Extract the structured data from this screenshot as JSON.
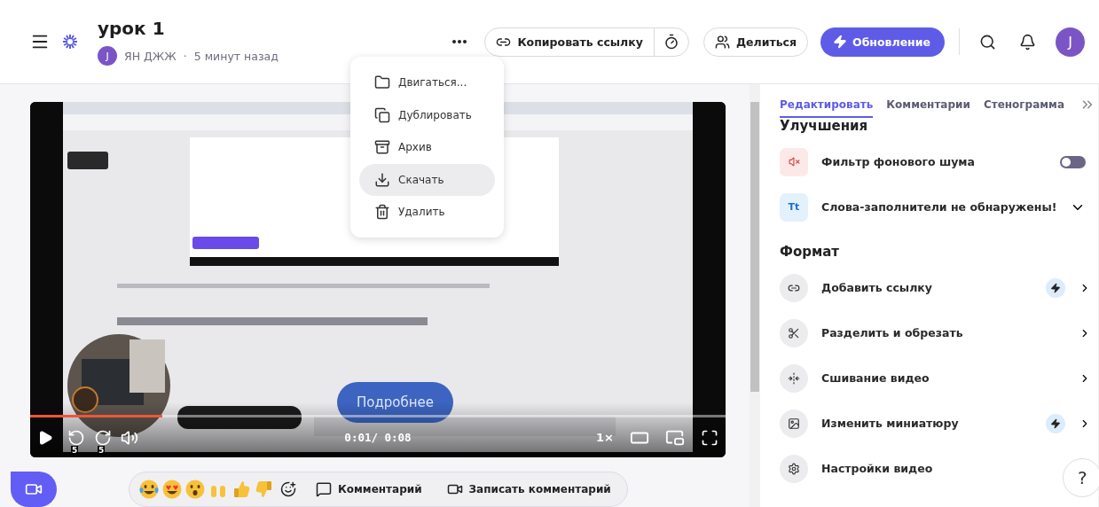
{
  "header": {
    "title": "урок 1",
    "author_initial": "J",
    "author": "ЯН ДЖЖ",
    "separator": "·",
    "time": "5 минут назад",
    "copy_link": "Копировать ссылку",
    "share": "Делиться",
    "upgrade": "Обновление",
    "avatar_initial": "J"
  },
  "menu": {
    "items": [
      {
        "label": "Двигаться...",
        "selected": false
      },
      {
        "label": "Дублировать",
        "selected": false
      },
      {
        "label": "Архив",
        "selected": false
      },
      {
        "label": "Скачать",
        "selected": true
      },
      {
        "label": "Удалить",
        "selected": false
      }
    ]
  },
  "video": {
    "cta": "Подробнее",
    "progress": {
      "level": 0.19
    },
    "skip_back": "5",
    "skip_forward": "5",
    "time": "0:01/ 0:08",
    "speed": "1×"
  },
  "reactions": {
    "comment": "Комментарий",
    "record_comment": "Записать комментарий"
  },
  "sidebar": {
    "tabs": [
      {
        "label": "Редактировать",
        "selected": true
      },
      {
        "label": "Комментарии",
        "selected": false
      },
      {
        "label": "Стенограмма",
        "selected": false
      }
    ],
    "sections": [
      {
        "title": "Улучшения",
        "items": [
          {
            "kind": "toggle",
            "label": "Фильтр фонового шума",
            "on": false
          },
          {
            "kind": "expand",
            "icon_text": "Tt",
            "label": "Слова-заполнители не обнаружены!",
            "expanded": false
          }
        ]
      },
      {
        "title": "Формат",
        "items": [
          {
            "kind": "link",
            "label": "Добавить ссылку",
            "premium": true
          },
          {
            "kind": "link",
            "label": "Разделить и обрезать",
            "premium": false
          },
          {
            "kind": "link",
            "label": "Сшивание видео",
            "premium": false
          },
          {
            "kind": "link",
            "label": "Изменить миниатюру",
            "premium": true
          },
          {
            "kind": "link",
            "label": "Настройки видео",
            "premium": false
          }
        ]
      }
    ]
  },
  "help": "?"
}
